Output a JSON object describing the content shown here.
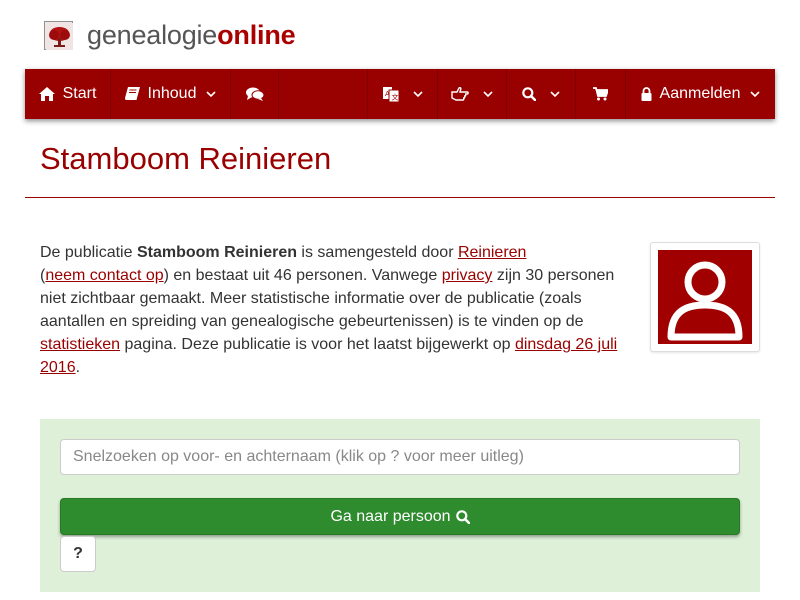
{
  "logo": {
    "text_part1": "genealogie",
    "text_part2": "online",
    "icon": "tree-icon"
  },
  "nav": {
    "start_label": "Start",
    "inhoud_label": "Inhoud",
    "chat_icon": "comments-icon",
    "language_icon": "language-icon",
    "share_icon": "share-icon",
    "search_icon": "search-icon",
    "cart_icon": "cart-icon",
    "login_label": "Aanmelden",
    "color": "#990000"
  },
  "page": {
    "title": "Stamboom Reinieren"
  },
  "intro": {
    "t1": "De publicatie ",
    "pub_name": "Stamboom Reinieren",
    "t2": " is samengesteld door ",
    "author_link": "Reinieren",
    "t3": " (",
    "contact_link": "neem contact op",
    "t4": ") en bestaat uit 46 personen. Vanwege ",
    "privacy_link": "privacy",
    "t5": " zijn 30 personen niet zichtbaar gemaakt. Meer statistische informatie over de publicatie (zoals aantallen en spreiding van genealogische gebeurtenissen) is te vinden op de ",
    "stats_link": "statistieken",
    "t6": " pagina. Deze publicatie is voor het laatst bijgewerkt op ",
    "date_link": "dinsdag 26 juli 2016",
    "t7": "."
  },
  "avatar": {
    "icon": "user-icon"
  },
  "search": {
    "placeholder": "Snelzoeken op voor- en achternaam (klik op ? voor meer uitleg)",
    "go_label": "Ga naar persoon",
    "help_label": "?"
  }
}
